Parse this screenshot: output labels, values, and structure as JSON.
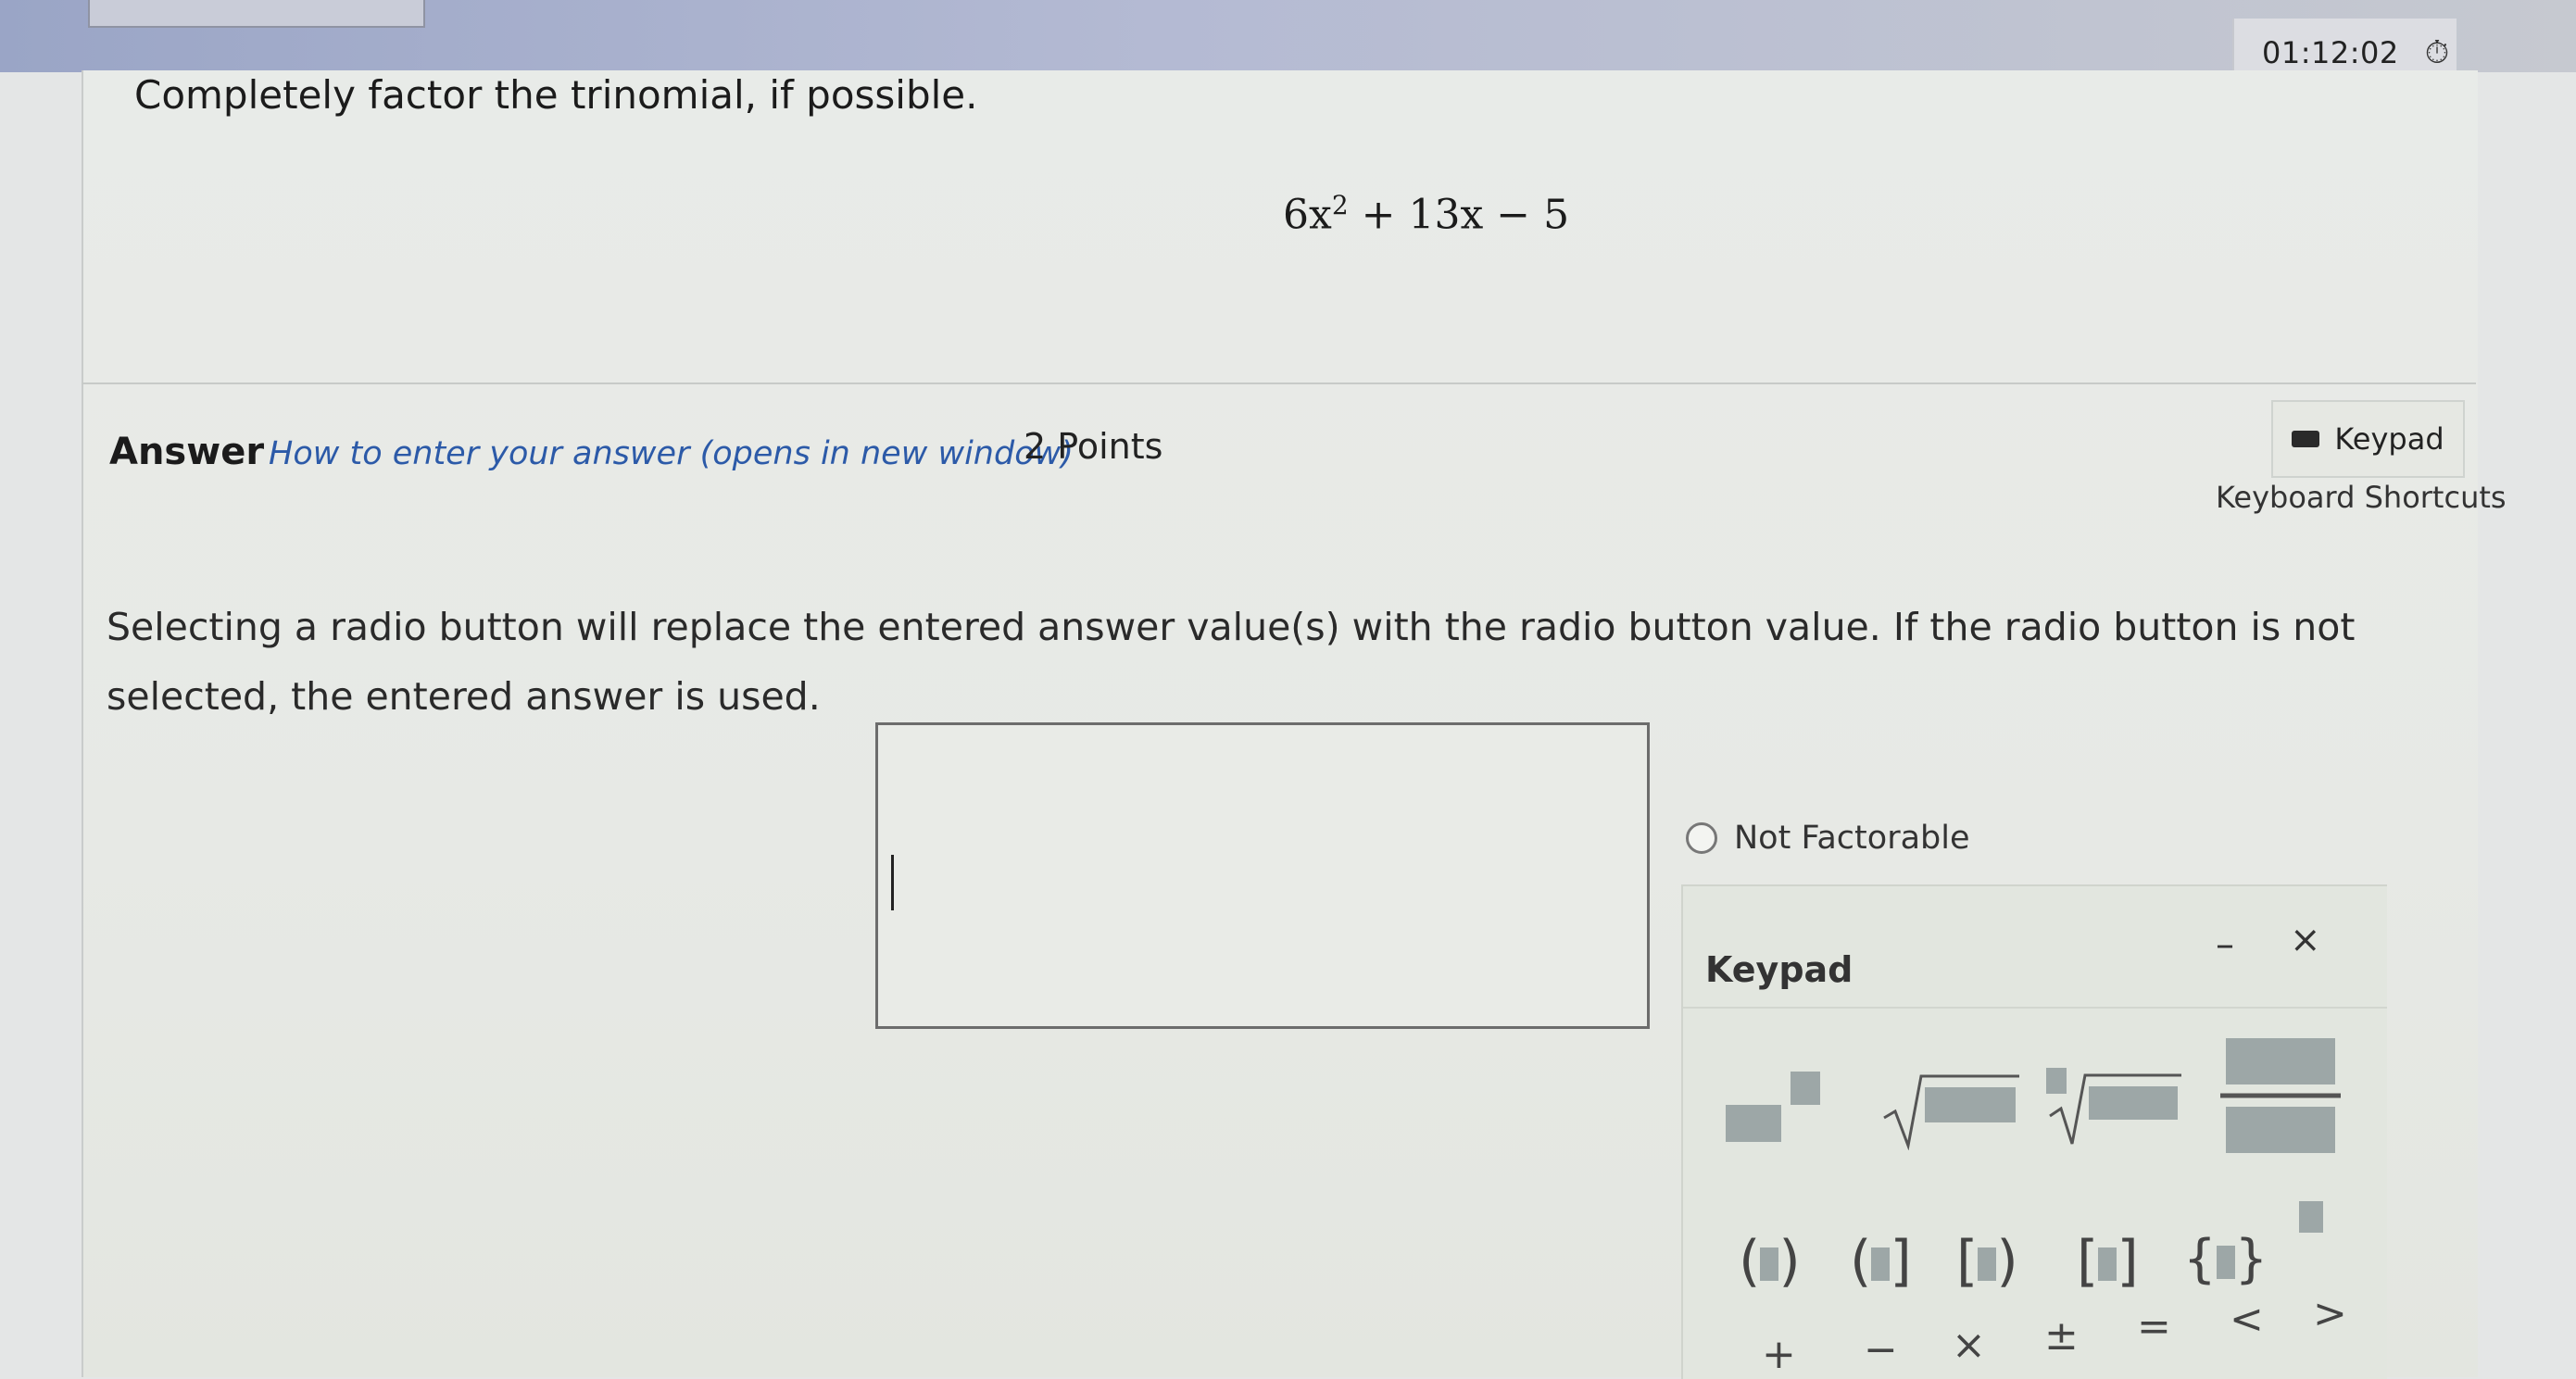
{
  "timer": {
    "text": "01:12:02",
    "icon": "stopwatch-icon"
  },
  "question": {
    "prompt": "Completely factor the trinomial, if possible.",
    "expression_lead": "6x",
    "expression_exp": "2",
    "expression_tail": " + 13x − 5"
  },
  "answer": {
    "heading": "Answer",
    "howto_link": "How to enter your answer (opens in new window)",
    "points": "2 Points",
    "keypad_button": "Keypad",
    "keyboard_shortcuts": "Keyboard Shortcuts",
    "instructions": "Selecting a radio button will replace the entered answer value(s) with the radio button value. If the radio button is not selected, the entered answer is used.",
    "input_value": "",
    "radio_option": "Not Factorable"
  },
  "keypad": {
    "title": "Keypad",
    "minimize_label": "–",
    "close_label": "×",
    "grouping_keys": [
      "(",
      ")",
      "(",
      "]",
      "[",
      ")",
      "[",
      "]",
      "{",
      "}"
    ],
    "operators": [
      "+",
      "−",
      "×",
      "±",
      "=",
      "<",
      ">"
    ]
  }
}
